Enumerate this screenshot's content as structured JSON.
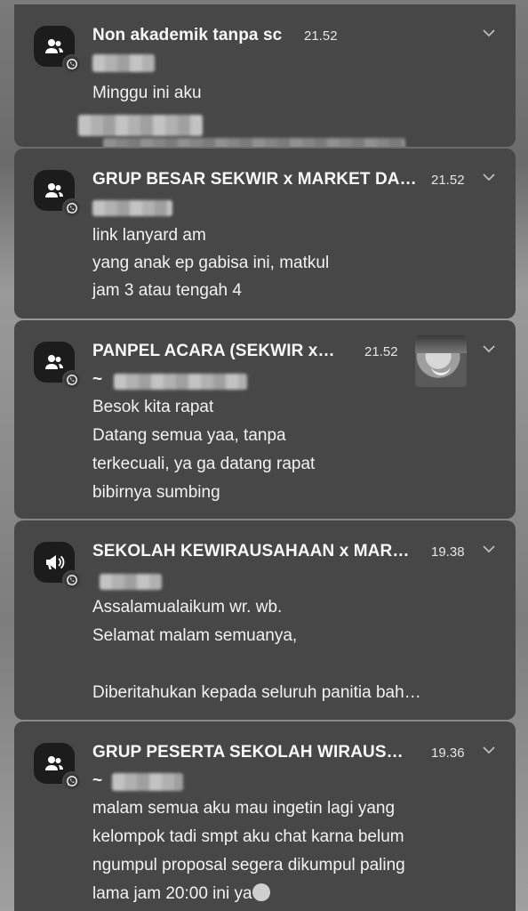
{
  "notifications": [
    {
      "icon": "group-icon",
      "title": "Non akademik tanpa sc",
      "time": "21.52",
      "lines": [
        "Minggu ini aku"
      ]
    },
    {
      "icon": "group-icon",
      "title": "GRUP BESAR SEKWIR x MARKET DA…",
      "time": "21.52",
      "lines": [
        "link lanyard am",
        "yang anak ep gabisa ini, matkul",
        "jam 3 atau tengah 4"
      ]
    },
    {
      "icon": "group-icon",
      "title": "PANPEL ACARA (SEKWIR x…",
      "time": "21.52",
      "sender": "~",
      "lines": [
        "Besok kita rapat",
        "Datang semua yaa, tanpa",
        "terkecuali, ya ga datang rapat",
        "bibirnya sumbing"
      ]
    },
    {
      "icon": "megaphone-icon",
      "title": "SEKOLAH KEWIRAUSAHAAN x MAR…",
      "time": "19.38",
      "lines": [
        "Assalamualaikum wr. wb.",
        "Selamat malam semuanya,",
        "",
        "Diberitahukan kepada seluruh panitia bah…"
      ]
    },
    {
      "icon": "group-icon",
      "title": "GRUP PESERTA SEKOLAH WIRAUS…",
      "time": "19.36",
      "sender": "~",
      "lines": [
        "malam semua aku mau ingetin lagi yang",
        "kelompok tadi smpt aku chat karna belum",
        "ngumpul proposal segera dikumpul paling",
        "lama jam 20:00 ini ya"
      ]
    }
  ],
  "colors": {
    "card": "#474747",
    "icon_bg": "#1c1c1c",
    "text": "#f2f2f2"
  }
}
